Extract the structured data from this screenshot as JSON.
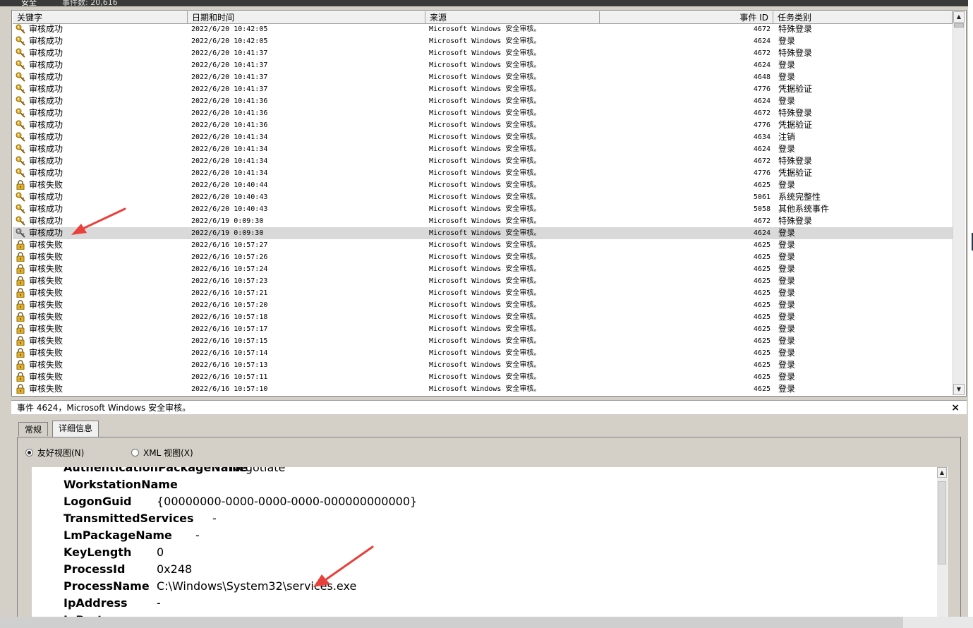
{
  "window": {
    "pane_title": "安全",
    "event_count_label": "事件数: 20,616"
  },
  "list": {
    "columns": [
      "关键字",
      "日期和时间",
      "来源",
      "事件 ID",
      "任务类别"
    ],
    "rows": [
      {
        "icon": "key-icon",
        "keyword": "审核成功",
        "datetime": "2022/6/20 10:42:05",
        "source": "Microsoft Windows 安全审核。",
        "event_id": "4672",
        "category": "特殊登录"
      },
      {
        "icon": "key-icon",
        "keyword": "审核成功",
        "datetime": "2022/6/20 10:42:05",
        "source": "Microsoft Windows 安全审核。",
        "event_id": "4624",
        "category": "登录"
      },
      {
        "icon": "key-icon",
        "keyword": "审核成功",
        "datetime": "2022/6/20 10:41:37",
        "source": "Microsoft Windows 安全审核。",
        "event_id": "4672",
        "category": "特殊登录"
      },
      {
        "icon": "key-icon",
        "keyword": "审核成功",
        "datetime": "2022/6/20 10:41:37",
        "source": "Microsoft Windows 安全审核。",
        "event_id": "4624",
        "category": "登录"
      },
      {
        "icon": "key-icon",
        "keyword": "审核成功",
        "datetime": "2022/6/20 10:41:37",
        "source": "Microsoft Windows 安全审核。",
        "event_id": "4648",
        "category": "登录"
      },
      {
        "icon": "key-icon",
        "keyword": "审核成功",
        "datetime": "2022/6/20 10:41:37",
        "source": "Microsoft Windows 安全审核。",
        "event_id": "4776",
        "category": "凭据验证"
      },
      {
        "icon": "key-icon",
        "keyword": "审核成功",
        "datetime": "2022/6/20 10:41:36",
        "source": "Microsoft Windows 安全审核。",
        "event_id": "4624",
        "category": "登录"
      },
      {
        "icon": "key-icon",
        "keyword": "审核成功",
        "datetime": "2022/6/20 10:41:36",
        "source": "Microsoft Windows 安全审核。",
        "event_id": "4672",
        "category": "特殊登录"
      },
      {
        "icon": "key-icon",
        "keyword": "审核成功",
        "datetime": "2022/6/20 10:41:36",
        "source": "Microsoft Windows 安全审核。",
        "event_id": "4776",
        "category": "凭据验证"
      },
      {
        "icon": "key-icon",
        "keyword": "审核成功",
        "datetime": "2022/6/20 10:41:34",
        "source": "Microsoft Windows 安全审核。",
        "event_id": "4634",
        "category": "注销"
      },
      {
        "icon": "key-icon",
        "keyword": "审核成功",
        "datetime": "2022/6/20 10:41:34",
        "source": "Microsoft Windows 安全审核。",
        "event_id": "4624",
        "category": "登录"
      },
      {
        "icon": "key-icon",
        "keyword": "审核成功",
        "datetime": "2022/6/20 10:41:34",
        "source": "Microsoft Windows 安全审核。",
        "event_id": "4672",
        "category": "特殊登录"
      },
      {
        "icon": "key-icon",
        "keyword": "审核成功",
        "datetime": "2022/6/20 10:41:34",
        "source": "Microsoft Windows 安全审核。",
        "event_id": "4776",
        "category": "凭据验证"
      },
      {
        "icon": "lock-icon",
        "keyword": "审核失败",
        "datetime": "2022/6/20 10:40:44",
        "source": "Microsoft Windows 安全审核。",
        "event_id": "4625",
        "category": "登录"
      },
      {
        "icon": "key-icon",
        "keyword": "审核成功",
        "datetime": "2022/6/20 10:40:43",
        "source": "Microsoft Windows 安全审核。",
        "event_id": "5061",
        "category": "系统完整性"
      },
      {
        "icon": "key-icon",
        "keyword": "审核成功",
        "datetime": "2022/6/20 10:40:43",
        "source": "Microsoft Windows 安全审核。",
        "event_id": "5058",
        "category": "其他系统事件"
      },
      {
        "icon": "key-icon",
        "keyword": "审核成功",
        "datetime": "2022/6/19 0:09:30",
        "source": "Microsoft Windows 安全审核。",
        "event_id": "4672",
        "category": "特殊登录"
      },
      {
        "icon": "key-icon",
        "keyword": "审核成功",
        "datetime": "2022/6/19 0:09:30",
        "source": "Microsoft Windows 安全审核。",
        "event_id": "4624",
        "category": "登录",
        "selected": true
      },
      {
        "icon": "lock-icon",
        "keyword": "审核失败",
        "datetime": "2022/6/16 10:57:27",
        "source": "Microsoft Windows 安全审核。",
        "event_id": "4625",
        "category": "登录"
      },
      {
        "icon": "lock-icon",
        "keyword": "审核失败",
        "datetime": "2022/6/16 10:57:26",
        "source": "Microsoft Windows 安全审核。",
        "event_id": "4625",
        "category": "登录"
      },
      {
        "icon": "lock-icon",
        "keyword": "审核失败",
        "datetime": "2022/6/16 10:57:24",
        "source": "Microsoft Windows 安全审核。",
        "event_id": "4625",
        "category": "登录"
      },
      {
        "icon": "lock-icon",
        "keyword": "审核失败",
        "datetime": "2022/6/16 10:57:23",
        "source": "Microsoft Windows 安全审核。",
        "event_id": "4625",
        "category": "登录"
      },
      {
        "icon": "lock-icon",
        "keyword": "审核失败",
        "datetime": "2022/6/16 10:57:21",
        "source": "Microsoft Windows 安全审核。",
        "event_id": "4625",
        "category": "登录"
      },
      {
        "icon": "lock-icon",
        "keyword": "审核失败",
        "datetime": "2022/6/16 10:57:20",
        "source": "Microsoft Windows 安全审核。",
        "event_id": "4625",
        "category": "登录"
      },
      {
        "icon": "lock-icon",
        "keyword": "审核失败",
        "datetime": "2022/6/16 10:57:18",
        "source": "Microsoft Windows 安全审核。",
        "event_id": "4625",
        "category": "登录"
      },
      {
        "icon": "lock-icon",
        "keyword": "审核失败",
        "datetime": "2022/6/16 10:57:17",
        "source": "Microsoft Windows 安全审核。",
        "event_id": "4625",
        "category": "登录"
      },
      {
        "icon": "lock-icon",
        "keyword": "审核失败",
        "datetime": "2022/6/16 10:57:15",
        "source": "Microsoft Windows 安全审核。",
        "event_id": "4625",
        "category": "登录"
      },
      {
        "icon": "lock-icon",
        "keyword": "审核失败",
        "datetime": "2022/6/16 10:57:14",
        "source": "Microsoft Windows 安全审核。",
        "event_id": "4625",
        "category": "登录"
      },
      {
        "icon": "lock-icon",
        "keyword": "审核失败",
        "datetime": "2022/6/16 10:57:13",
        "source": "Microsoft Windows 安全审核。",
        "event_id": "4625",
        "category": "登录"
      },
      {
        "icon": "lock-icon",
        "keyword": "审核失败",
        "datetime": "2022/6/16 10:57:11",
        "source": "Microsoft Windows 安全审核。",
        "event_id": "4625",
        "category": "登录"
      },
      {
        "icon": "lock-icon",
        "keyword": "审核失败",
        "datetime": "2022/6/16 10:57:10",
        "source": "Microsoft Windows 安全审核。",
        "event_id": "4625",
        "category": "登录"
      }
    ]
  },
  "details": {
    "title": "事件 4624，Microsoft Windows 安全审核。",
    "close_label": "×",
    "tabs": [
      "常规",
      "详细信息"
    ],
    "active_tab": "详细信息",
    "views": {
      "friendly": "友好视图(N)",
      "xml": "XML 视图(X)"
    },
    "selected_view": "friendly",
    "properties": [
      {
        "name": "AuthenticationPackageName",
        "value": "Negotiate"
      },
      {
        "name": "WorkstationName",
        "value": ""
      },
      {
        "name": "LogonGuid",
        "value": "{00000000-0000-0000-0000-000000000000}"
      },
      {
        "name": "TransmittedServices",
        "value": "-"
      },
      {
        "name": "LmPackageName",
        "value": "-"
      },
      {
        "name": "KeyLength",
        "value": "0"
      },
      {
        "name": "ProcessId",
        "value": "0x248"
      },
      {
        "name": "ProcessName",
        "value": "C:\\Windows\\System32\\services.exe"
      },
      {
        "name": "IpAddress",
        "value": "-"
      },
      {
        "name": "IpPort",
        "value": ""
      }
    ]
  },
  "colors": {
    "selected_row": "#d9d9d9",
    "annotation_arrow": "#e8403a",
    "key_icon": "#d9a520",
    "lock_icon": "#c89a1e"
  }
}
